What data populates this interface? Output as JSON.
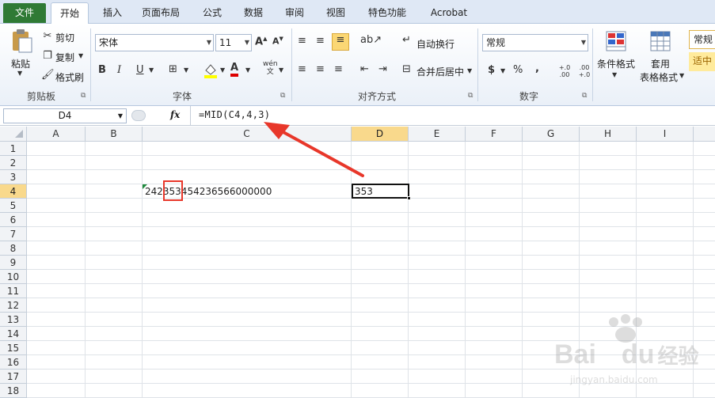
{
  "tabs": {
    "file": "文件",
    "home": "开始",
    "insert": "插入",
    "layout": "页面布局",
    "formula": "公式",
    "data": "数据",
    "review": "审阅",
    "view": "视图",
    "special": "特色功能",
    "acrobat": "Acrobat"
  },
  "clipboard": {
    "paste": "粘贴",
    "cut": "剪切",
    "copy": "复制",
    "painter": "格式刷",
    "group": "剪贴板"
  },
  "font": {
    "name": "宋体",
    "size": "11",
    "group": "字体",
    "wen": "wén"
  },
  "align": {
    "wrap": "自动换行",
    "merge": "合并后居中",
    "group": "对齐方式"
  },
  "number": {
    "format": "常规",
    "currency": "$",
    "percent": "%",
    "comma": ",",
    "inc_decimal": "+.0 .00",
    "dec_decimal": ".00 +.0",
    "group": "数字"
  },
  "styles": {
    "conditional": "条件格式",
    "table_1": "套用",
    "table_2": "表格格式",
    "style_normal": "常规",
    "style_neutral": "适中"
  },
  "formula_bar": {
    "name_box": "D4",
    "fx": "fx",
    "formula": "=MID(C4,4,3)"
  },
  "columns": [
    "A",
    "B",
    "C",
    "D",
    "E",
    "F",
    "G",
    "H",
    "I"
  ],
  "rows": [
    "1",
    "2",
    "3",
    "4",
    "5",
    "6",
    "7",
    "8",
    "9",
    "10",
    "11",
    "12",
    "13",
    "14",
    "15",
    "16",
    "17",
    "18"
  ],
  "cells": {
    "C4": "242353454236566000000",
    "D4": "353"
  },
  "watermark": {
    "brand": "Bai",
    "brand2": "du",
    "site": "经验",
    "url": "jingyan.baidu.com"
  },
  "colors": {
    "accent": "#2f7a35",
    "arrow": "#e8372a",
    "highlight": "#e8372a"
  }
}
